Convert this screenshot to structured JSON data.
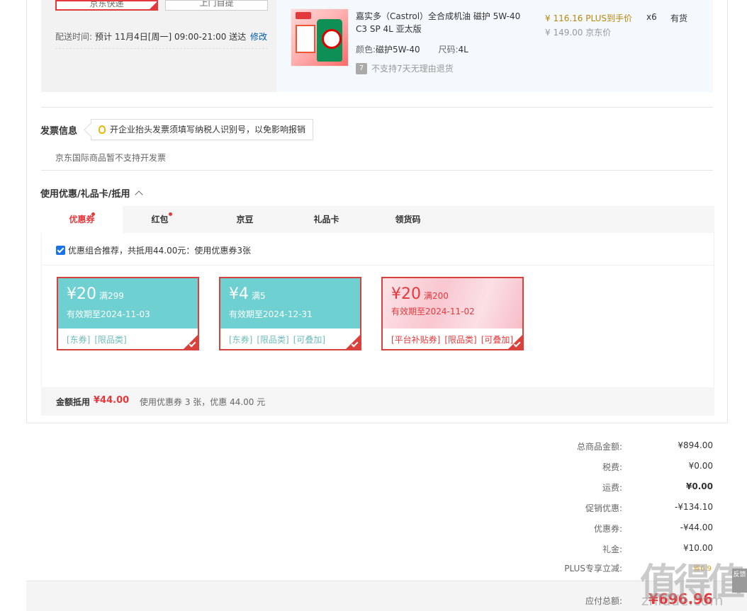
{
  "shipping": {
    "option_selected": "京东快递",
    "option_other": "上门自提",
    "delivery_label": "配送时间:",
    "delivery_value": "预计 11月4日[周一] 09:00-21:00 送达",
    "edit_label": "修改"
  },
  "product": {
    "name": "嘉实多（Castrol）全合成机油 磁护 5W-40 C3 SP 4L 亚太版",
    "color_label": "颜色:",
    "color_value": "磁护5W-40",
    "size_label": "尺码:",
    "size_value": "4L",
    "return_icon": "7",
    "return_note": "不支持7天无理由退货",
    "price_plus": "¥ 116.16 PLUS到手价",
    "price_jd": "¥ 149.00 京东价",
    "quantity": "x6",
    "stock": "有货"
  },
  "invoice": {
    "title": "发票信息",
    "tip": "开企业抬头发票须填写纳税人识别号，以免影响报销",
    "note": "京东国际商品暂不支持开发票"
  },
  "coupons": {
    "title": "使用优惠/礼品卡/抵用",
    "tabs": [
      {
        "label": "优惠券"
      },
      {
        "label": "红包"
      },
      {
        "label": "京豆"
      },
      {
        "label": "礼品卡"
      },
      {
        "label": "领货码"
      }
    ],
    "combo_text": "优惠组合推荐，共抵用44.00元：使用优惠券3张",
    "items": [
      {
        "amount": "¥20",
        "threshold": "满299",
        "valid": "有效期至2024-11-03",
        "tags": [
          "[东券]",
          "[限品类]"
        ]
      },
      {
        "amount": "¥4",
        "threshold": "满5",
        "valid": "有效期至2024-12-31",
        "tags": [
          "[东券]",
          "[限品类]",
          "[可叠加]"
        ]
      },
      {
        "amount": "¥20",
        "threshold": "满200",
        "valid": "有效期至2024-11-02",
        "tags": [
          "[平台补贴券]",
          "[限品类]",
          "[可叠加]"
        ]
      }
    ],
    "summary_label": "金额抵用",
    "summary_amount": "¥44.00",
    "summary_text": "使用优惠券 3 张，优惠 44.00 元"
  },
  "totals": {
    "rows": [
      {
        "label": "总商品金额:",
        "value": "¥894.00"
      },
      {
        "label": "税费:",
        "value": "¥0.00"
      },
      {
        "label": "运费:",
        "value": "¥0.00"
      },
      {
        "label": "促销优惠:",
        "value": "-¥134.10"
      },
      {
        "label": "优惠券:",
        "value": "-¥44.00"
      },
      {
        "label": "礼金:",
        "value": "¥10.00"
      }
    ],
    "plus_label": "PLUS专享立减:",
    "plus_value": "省6.9",
    "pay_label": "应付总额:",
    "pay_value": "¥696.96"
  },
  "watermark": {
    "text": "值得值",
    "url": "zhidde.com"
  },
  "side_button": "反馈"
}
